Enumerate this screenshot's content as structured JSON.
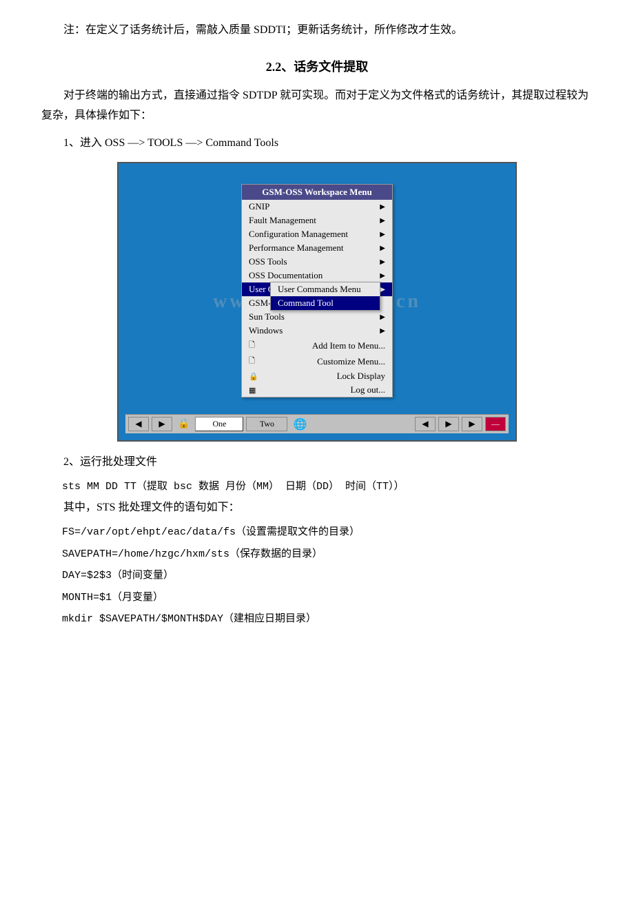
{
  "note": {
    "text": "注：在定义了话务统计后，需敲入质量 SDDTI；更新话务统计，所作修改才生效。"
  },
  "section": {
    "title": "2.2、话务文件提取"
  },
  "intro": {
    "para1": "对于终端的输出方式，直接通过指令 SDTDP 就可实现。而对于定义为文件格式的话务统计，其提取过程较为复杂，具体操作如下："
  },
  "steps": {
    "step1_label": "1、进入 OSS —> TOOLS —> Command Tools",
    "step2_label": "2、运行批处理文件",
    "step2_cmd": "sts MM DD TT（提取 bsc 数据   月份（MM） 日期（DD） 时间（TT））",
    "step2_note": "其中，STS 批处理文件的语句如下：",
    "code_lines": [
      "FS=/var/opt/ehpt/eac/data/fs（设置需提取文件的目录）",
      "SAVEPATH=/home/hzgc/hxm/sts（保存数据的目录）",
      "DAY=$2$3（时间变量）",
      "MONTH=$1（月变量）",
      "mkdir $SAVEPATH/$MONTH$DAY（建相应日期目录）"
    ]
  },
  "menu": {
    "header": "GSM-OSS Workspace Menu",
    "items": [
      {
        "label": "GNIP",
        "arrow": true
      },
      {
        "label": "Fault Management",
        "arrow": true
      },
      {
        "label": "Configuration Management",
        "arrow": true
      },
      {
        "label": "Performance Management",
        "arrow": true
      },
      {
        "label": "OSS Tools",
        "arrow": true
      },
      {
        "label": "OSS Documentation",
        "arrow": true
      },
      {
        "label": "User Commands",
        "arrow": true,
        "highlighted": true
      },
      {
        "label": "GSM-OSS Workspace Menu End",
        "arrow": false
      },
      {
        "label": "Sun Tools",
        "arrow": true
      },
      {
        "label": "Windows",
        "arrow": true
      },
      {
        "label": "Add Item to Menu...",
        "icon": "🗋"
      },
      {
        "label": "Customize Menu...",
        "icon": "🗋"
      },
      {
        "label": "Lock Display",
        "icon": "🔒"
      },
      {
        "label": "Log out...",
        "icon": "▦"
      }
    ]
  },
  "submenu": {
    "items": [
      {
        "label": "User Commands Menu",
        "highlighted": false
      },
      {
        "label": "Command Tool",
        "highlighted": true
      }
    ]
  },
  "taskbar": {
    "left_arrows": [
      "◀",
      "▶"
    ],
    "lock_icon": "🔒",
    "tab_one": "One",
    "tab_two": "Two",
    "globe_icon": "🌐",
    "right_arrows": [
      "◀",
      "▶",
      "▶"
    ],
    "red_block": "—"
  },
  "watermark": "www.OOXX.com.cn"
}
